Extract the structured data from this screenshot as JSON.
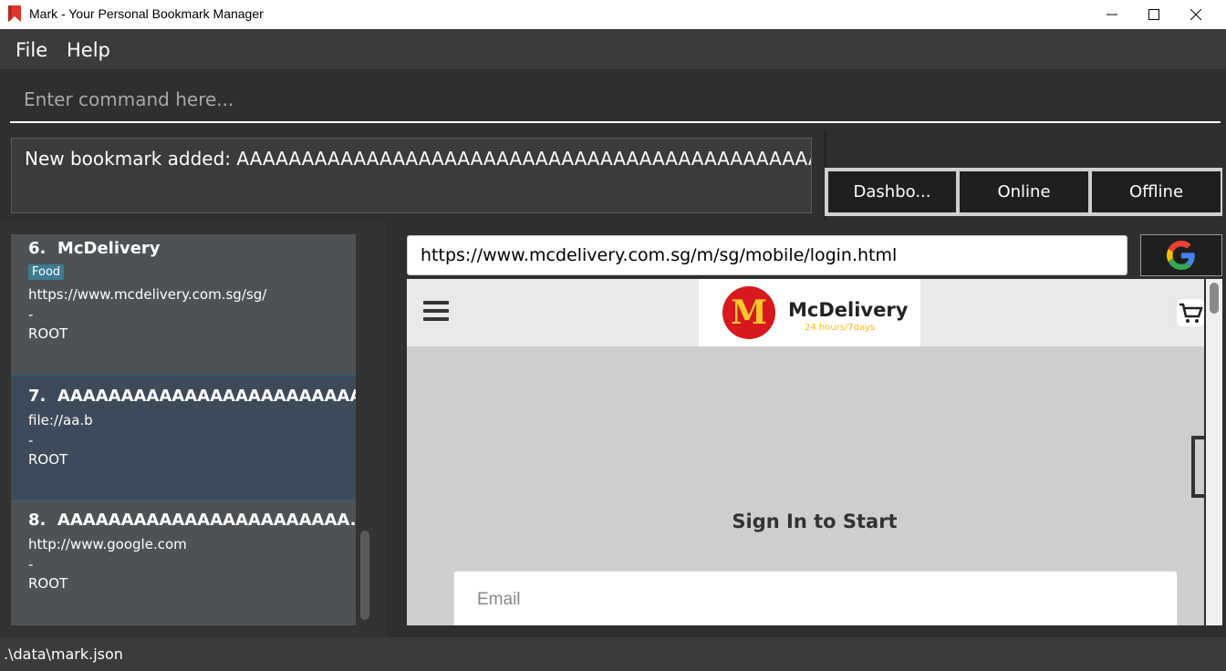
{
  "window": {
    "title": "Mark - Your Personal Bookmark Manager",
    "minimize": "—",
    "maximize": "☐",
    "close": "✕"
  },
  "menu": {
    "file": "File",
    "help": "Help"
  },
  "command": {
    "placeholder": "Enter command here..."
  },
  "result": {
    "text": "New bookmark added: AAAAAAAAAAAAAAAAAAAAAAAAAAAAAAAAAAAAAAAAAAAAAAAAAAAAAAAAAAAA"
  },
  "tabs": [
    {
      "label": "Dashbo..."
    },
    {
      "label": "Online"
    },
    {
      "label": "Offline"
    }
  ],
  "bookmarks": [
    {
      "index": "6.",
      "name": "McDelivery",
      "tag": "Food",
      "url": "https://www.mcdelivery.com.sg/sg/",
      "remark": "-",
      "folder": "ROOT"
    },
    {
      "index": "7.",
      "name": "AAAAAAAAAAAAAAAAAAAAAAAA",
      "url": "file://aa.b",
      "remark": "-",
      "folder": "ROOT"
    },
    {
      "index": "8.",
      "name": "AAAAAAAAAAAAAAAAAAAAAAA...",
      "url": "http://www.google.com",
      "remark": "-",
      "folder": "ROOT"
    }
  ],
  "browser": {
    "url": "https://www.mcdelivery.com.sg/m/sg/mobile/login.html",
    "site_name": "McDelivery",
    "site_tagline": "24 hours/7days",
    "logo_letter": "M",
    "signin_title": "Sign In to Start",
    "email_placeholder": "Email"
  },
  "status": {
    "path": ".\\data\\mark.json"
  },
  "colors": {
    "tag_bg": "#3e7b91",
    "selected_card": "#3d4a5a",
    "mcd_red": "#d7181f",
    "mcd_yellow": "#ffc72c"
  }
}
